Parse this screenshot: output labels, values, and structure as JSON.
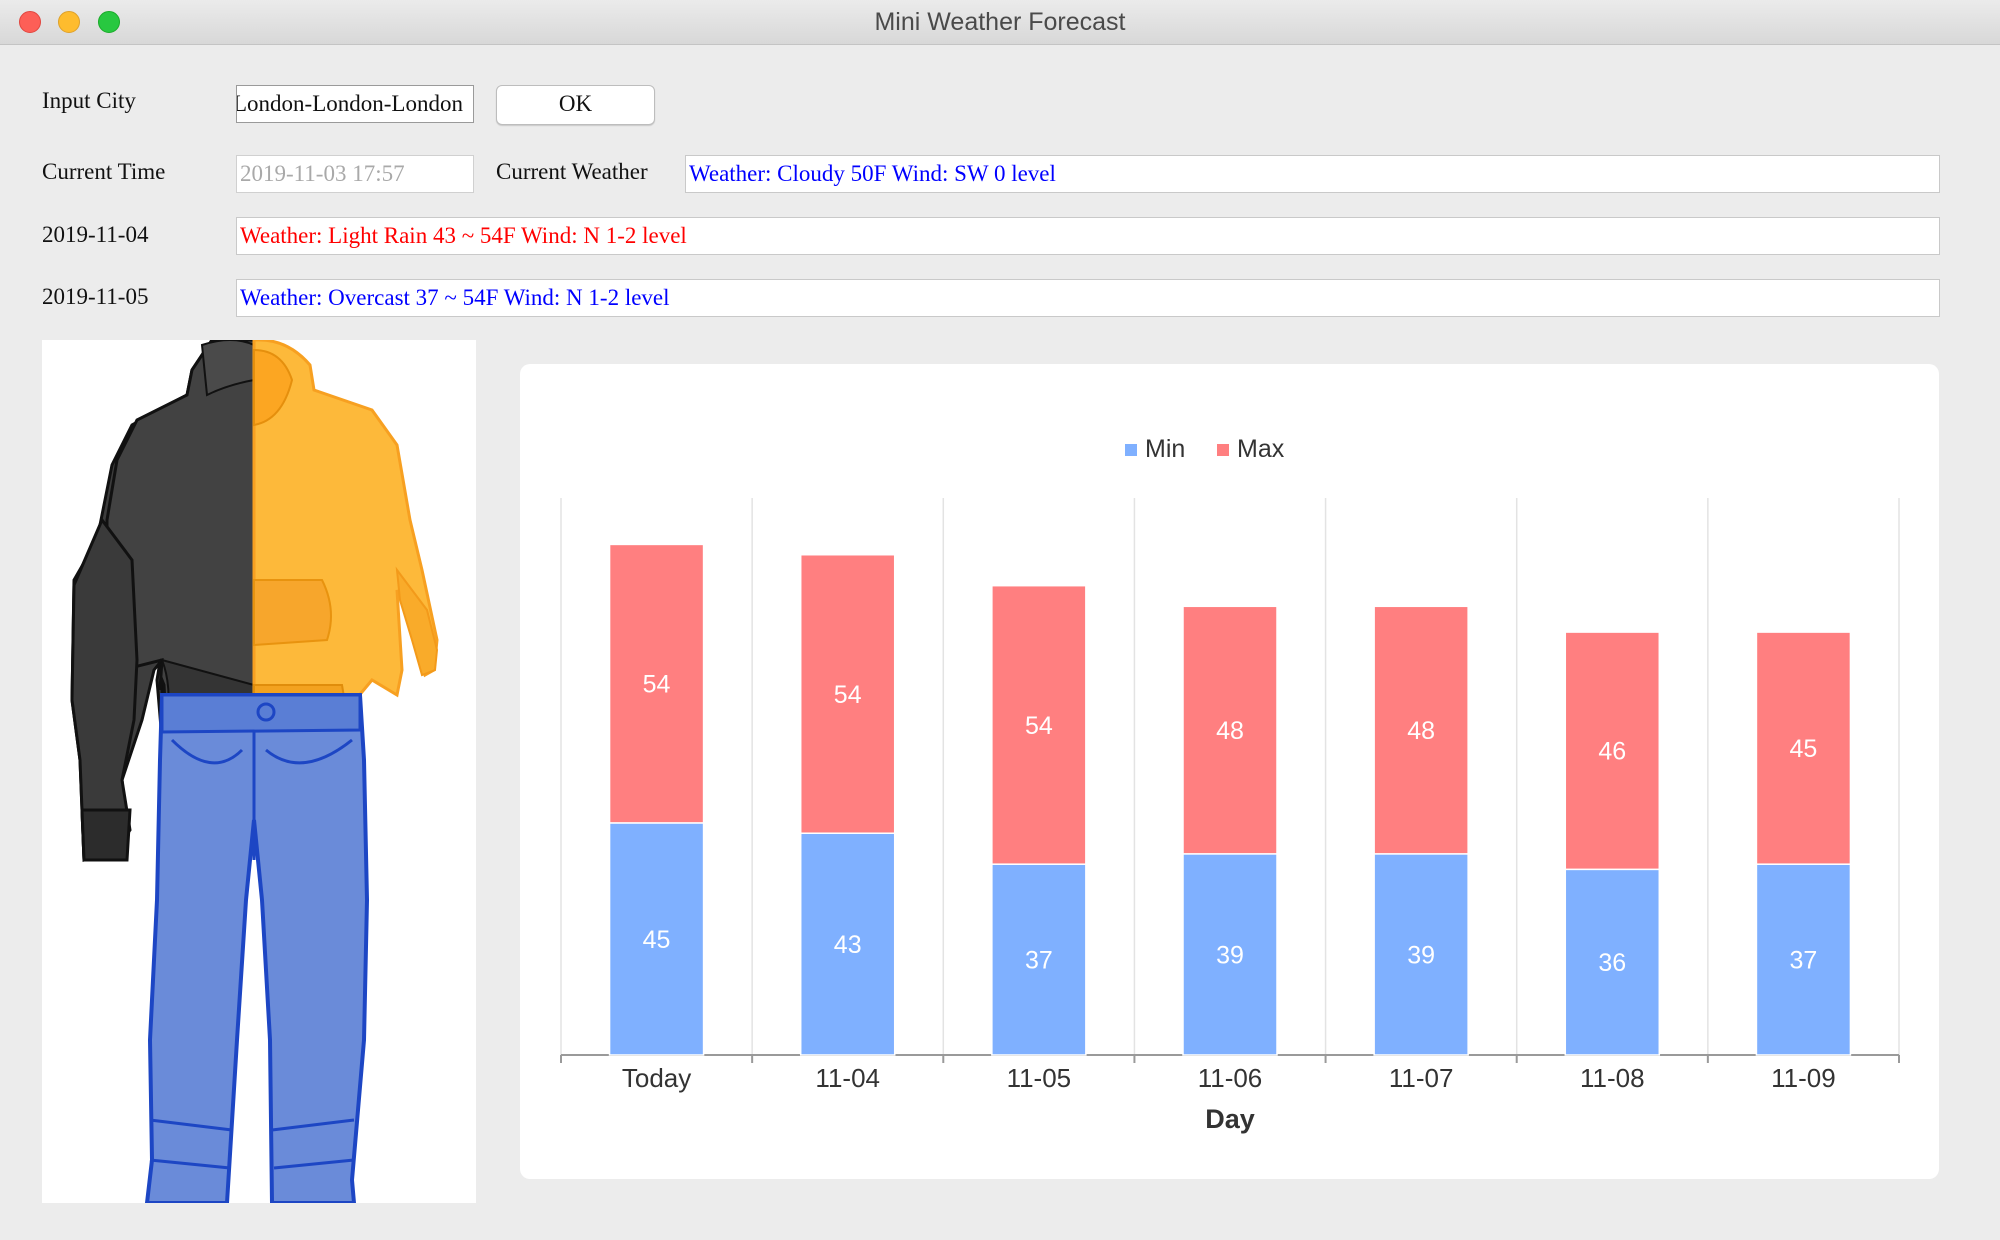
{
  "window": {
    "title": "Mini Weather Forecast"
  },
  "form": {
    "input_city_label": "Input City",
    "city_value": "London-London-London",
    "ok_label": "OK",
    "current_time_label": "Current Time",
    "current_time_value": "2019-11-03 17:57",
    "current_weather_label": "Current Weather",
    "current_weather_value": "Weather: Cloudy  50F  Wind: SW  0 level"
  },
  "forecast": [
    {
      "date": "2019-11-04",
      "text": "Weather: Light Rain  43 ~ 54F  Wind: N 1-2 level",
      "color": "#ff0000"
    },
    {
      "date": "2019-11-05",
      "text": "Weather: Overcast  37 ~ 54F  Wind: N 1-2 level",
      "color": "#0000ff"
    }
  ],
  "outfit": {
    "jacket": "hoodie",
    "pants": "jeans"
  },
  "chart_data": {
    "type": "bar",
    "stacked": true,
    "categories": [
      "Today",
      "11-04",
      "11-05",
      "11-06",
      "11-07",
      "11-08",
      "11-09"
    ],
    "series": [
      {
        "name": "Min",
        "color": "#7fb0ff",
        "values": [
          45,
          43,
          37,
          39,
          39,
          36,
          37
        ]
      },
      {
        "name": "Max",
        "color": "#ff7f80",
        "values": [
          54,
          54,
          54,
          48,
          48,
          46,
          45
        ]
      }
    ],
    "xlabel": "Day",
    "ylabel": "",
    "ylim": [
      0,
      108
    ],
    "legend": "top-center",
    "grid": "vertical"
  }
}
